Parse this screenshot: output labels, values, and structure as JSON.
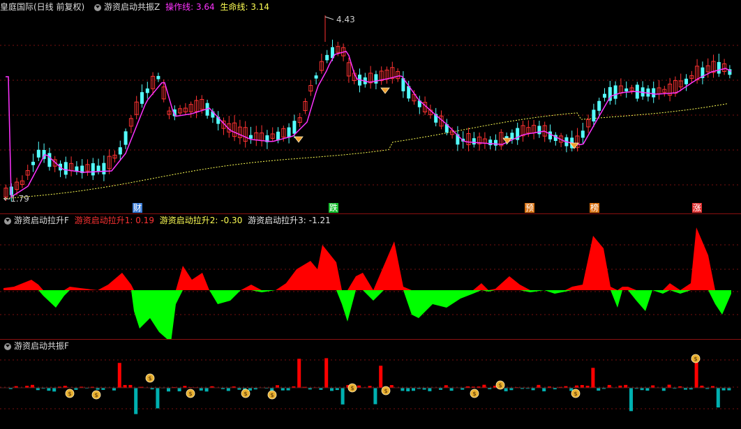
{
  "panel1": {
    "stock": "皇庭国际(日线 前复权)",
    "indicator": "游资启动共振Z",
    "op_label": "操作线: ",
    "op_value": "3.64",
    "life_label": "生命线: ",
    "life_value": "3.14",
    "price_high": "4.43",
    "price_low": "1.79",
    "markers": [
      "财",
      "跌",
      "预",
      "榜",
      "涨"
    ],
    "marker_colors": [
      "#3f7fd8",
      "#18c030",
      "#d87010",
      "#d87010",
      "#e03030"
    ]
  },
  "panel2": {
    "title": "游资启动拉升F",
    "l1_label": "游资启动拉升1: ",
    "l1_value": "0.19",
    "l2_label": "游资启动拉升2: ",
    "l2_value": "-0.30",
    "l3_label": "游资启动拉升3: ",
    "l3_value": "-1.21"
  },
  "panel3": {
    "title": "游资启动共振F"
  },
  "colors": {
    "up": "#ff3232",
    "down": "#54ffff",
    "ma": "#ff33ff",
    "life": "#ffff54",
    "area_up": "#ff0000",
    "area_down": "#00ff00",
    "bar_up": "#ff0000",
    "bar_down": "#00b0b0",
    "grid": "#7a1010"
  },
  "icons": {
    "diamond": "diamond-icon",
    "money_bag": "money-bag-icon"
  }
}
